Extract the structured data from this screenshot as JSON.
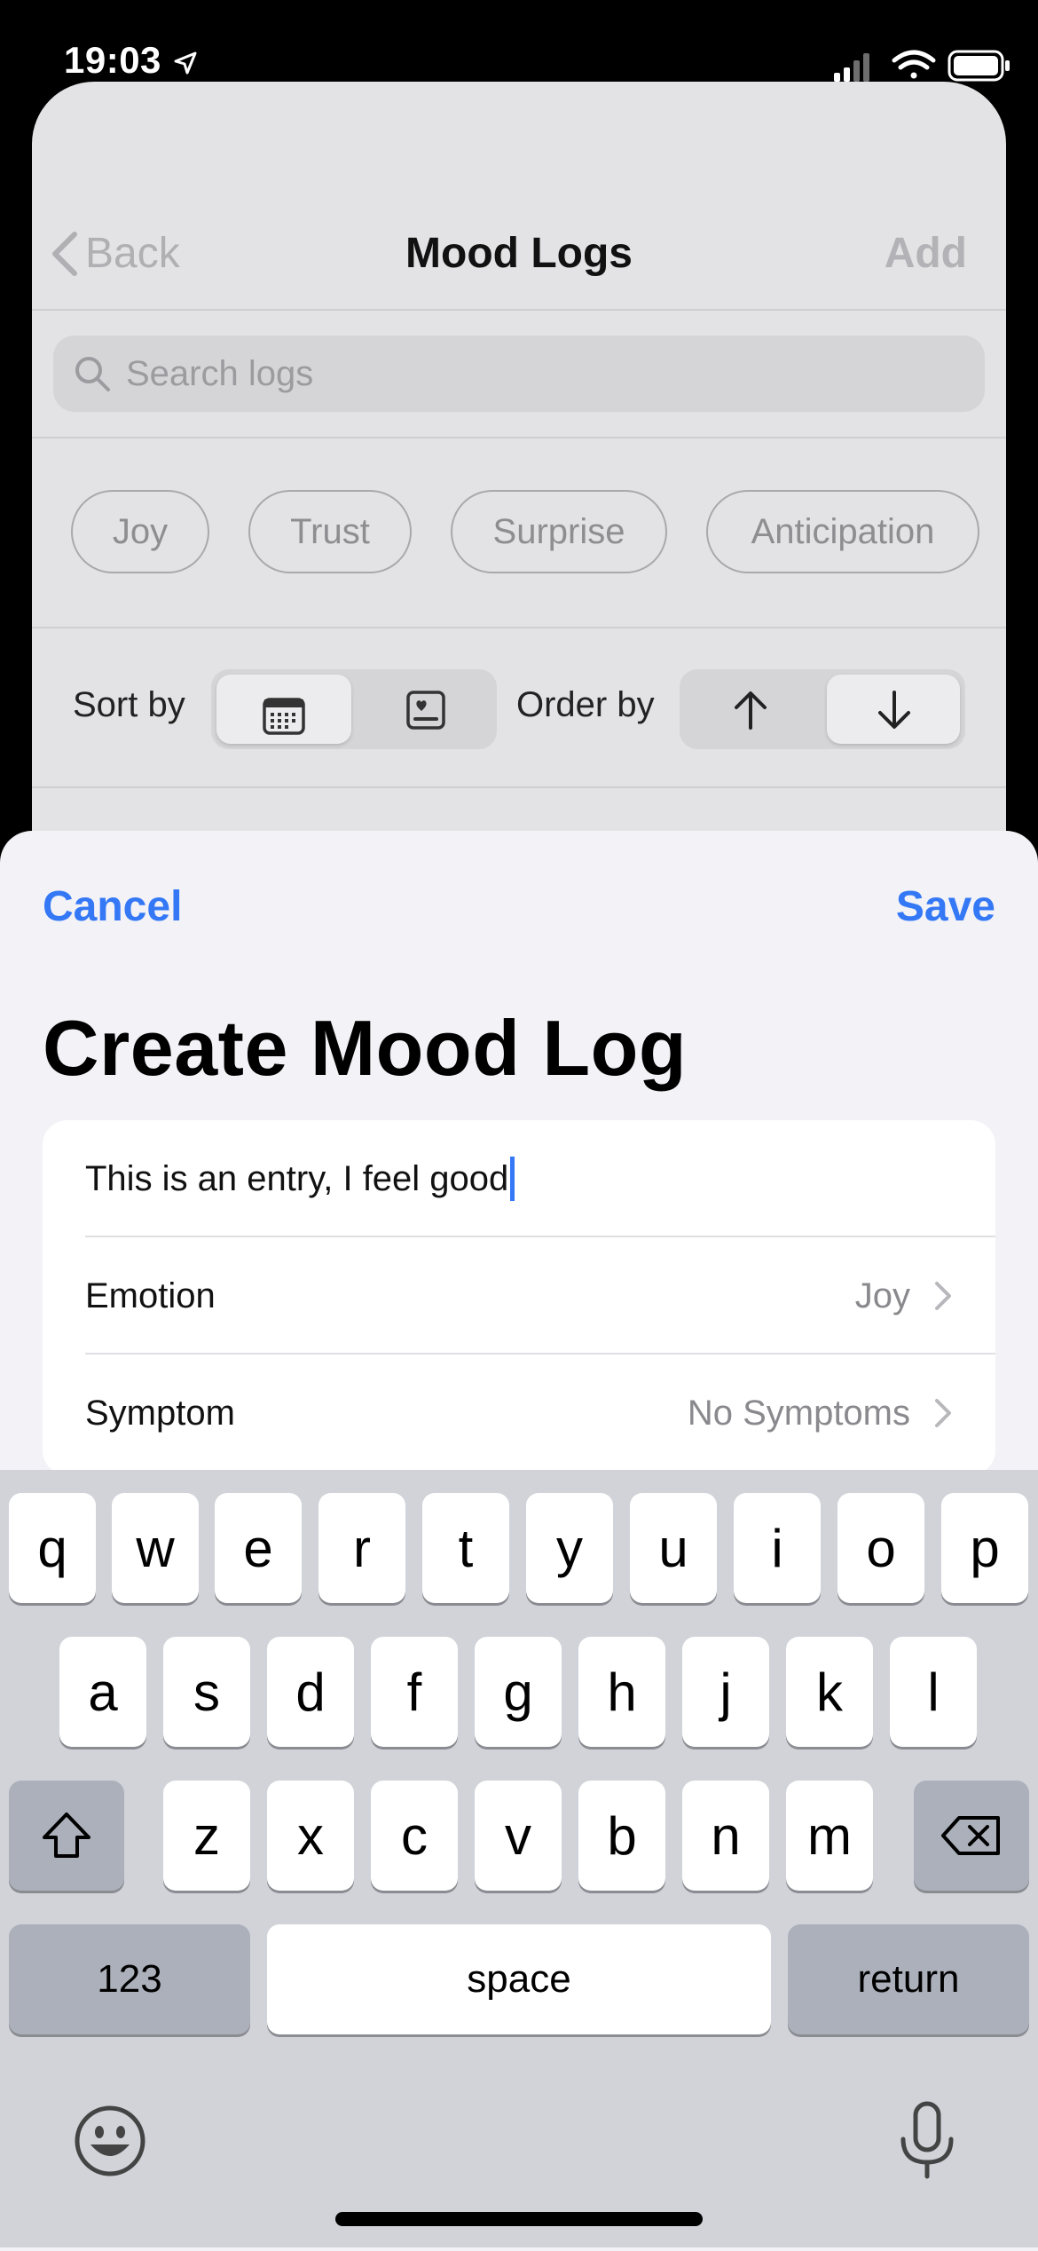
{
  "status": {
    "time": "19:03"
  },
  "nav": {
    "back_label": "Back",
    "title": "Mood Logs",
    "add_label": "Add"
  },
  "search": {
    "placeholder": "Search logs"
  },
  "chips": [
    "Joy",
    "Trust",
    "Surprise",
    "Anticipation"
  ],
  "sort": {
    "sort_label": "Sort by",
    "order_label": "Order by"
  },
  "sheet": {
    "cancel_label": "Cancel",
    "save_label": "Save",
    "title": "Create Mood Log",
    "entry_text": "This is an entry, I feel good",
    "rows": [
      {
        "label": "Emotion",
        "value": "Joy"
      },
      {
        "label": "Symptom",
        "value": "No Symptoms"
      }
    ]
  },
  "keyboard": {
    "row1": [
      "q",
      "w",
      "e",
      "r",
      "t",
      "y",
      "u",
      "i",
      "o",
      "p"
    ],
    "row2": [
      "a",
      "s",
      "d",
      "f",
      "g",
      "h",
      "j",
      "k",
      "l"
    ],
    "row3": [
      "z",
      "x",
      "c",
      "v",
      "b",
      "n",
      "m"
    ],
    "numbers_label": "123",
    "space_label": "space",
    "return_label": "return"
  },
  "colors": {
    "accent": "#3478f6",
    "sheet_bg": "#f2f2f7",
    "keyboard_bg": "#d1d3d9"
  }
}
